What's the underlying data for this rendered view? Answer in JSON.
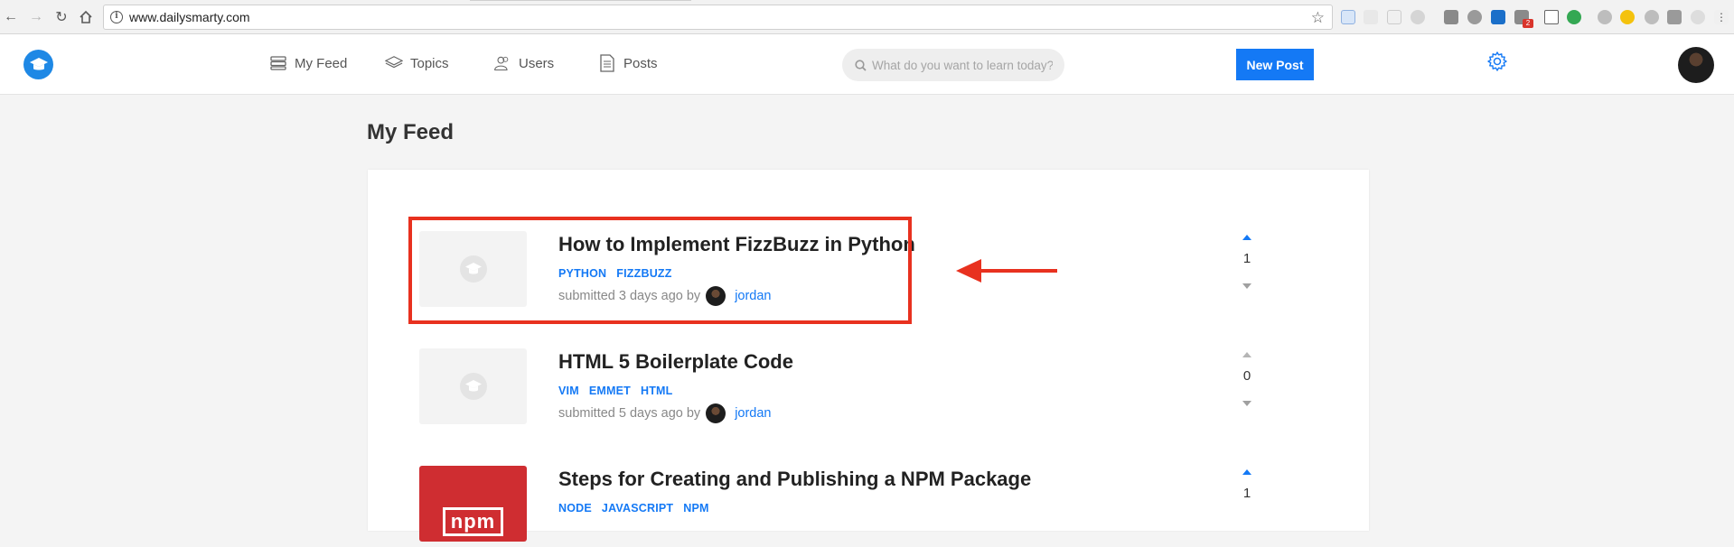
{
  "browser": {
    "url": "www.dailysmarty.com",
    "extension_badge": "2"
  },
  "header": {
    "nav": [
      {
        "label": "My Feed"
      },
      {
        "label": "Topics"
      },
      {
        "label": "Users"
      },
      {
        "label": "Posts"
      }
    ],
    "search_placeholder": "What do you want to learn today?",
    "new_post_label": "New Post"
  },
  "main": {
    "page_title": "My Feed",
    "posts": [
      {
        "title": "How to Implement FizzBuzz in Python",
        "tags": [
          "PYTHON",
          "FIZZBUZZ"
        ],
        "submitted": "submitted 3 days ago by",
        "author": "jordan",
        "votes": "1"
      },
      {
        "title": "HTML 5 Boilerplate Code",
        "tags": [
          "VIM",
          "EMMET",
          "HTML"
        ],
        "submitted": "submitted 5 days ago by",
        "author": "jordan",
        "votes": "0"
      },
      {
        "title": "Steps for Creating and Publishing a NPM Package",
        "tags": [
          "NODE",
          "JAVASCRIPT",
          "NPM"
        ],
        "submitted": "",
        "author": "",
        "votes": "1",
        "thumb_text": "npm"
      }
    ]
  },
  "colors": {
    "accent": "#1479f5",
    "annotation": "#e8311f",
    "npm_red": "#cf2d31"
  }
}
